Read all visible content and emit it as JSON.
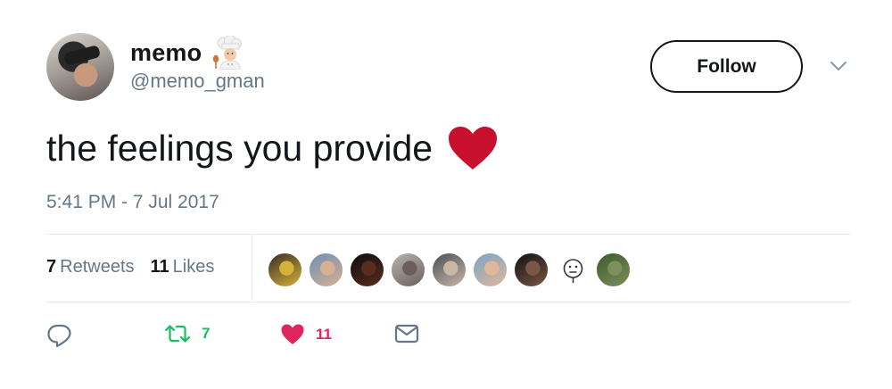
{
  "user": {
    "display_name": "memo",
    "handle": "@memo_gman",
    "name_emoji": "chef-icon"
  },
  "follow_label": "Follow",
  "tweet": {
    "text": "the feelings you provide",
    "emoji": "red-heart-icon",
    "timestamp": "5:41 PM - 7 Jul 2017"
  },
  "stats": {
    "retweets_count": "7",
    "retweets_label": "Retweets",
    "likes_count": "11",
    "likes_label": "Likes"
  },
  "likers": [
    {
      "name": "liker-avatar-1",
      "colors": [
        "#3a2b22",
        "#d4b23a"
      ]
    },
    {
      "name": "liker-avatar-2",
      "colors": [
        "#6c8fb8",
        "#d9b08f"
      ]
    },
    {
      "name": "liker-avatar-3",
      "colors": [
        "#0e0e0e",
        "#5a2c1e"
      ]
    },
    {
      "name": "liker-avatar-4",
      "colors": [
        "#b7b4b0",
        "#6b5f5a"
      ]
    },
    {
      "name": "liker-avatar-5",
      "colors": [
        "#4a4f5a",
        "#c9b7a6"
      ]
    },
    {
      "name": "liker-avatar-6",
      "colors": [
        "#7aa4c8",
        "#e0b799"
      ]
    },
    {
      "name": "liker-avatar-7",
      "colors": [
        "#111111",
        "#7a5646"
      ]
    },
    {
      "name": "liker-avatar-8",
      "colors": [
        "#ffffff",
        "#ffffff"
      ]
    },
    {
      "name": "liker-avatar-9",
      "colors": [
        "#3d5a2c",
        "#7d8f5b"
      ]
    }
  ],
  "actions": {
    "reply_icon": "reply-icon",
    "retweet_count": "7",
    "like_count": "11",
    "message_icon": "envelope-icon"
  },
  "colors": {
    "text": "#14171a",
    "secondary": "#657786",
    "retweet_green": "#17bf63",
    "like_red": "#e0245e",
    "heart_emoji": "#c8102e"
  }
}
